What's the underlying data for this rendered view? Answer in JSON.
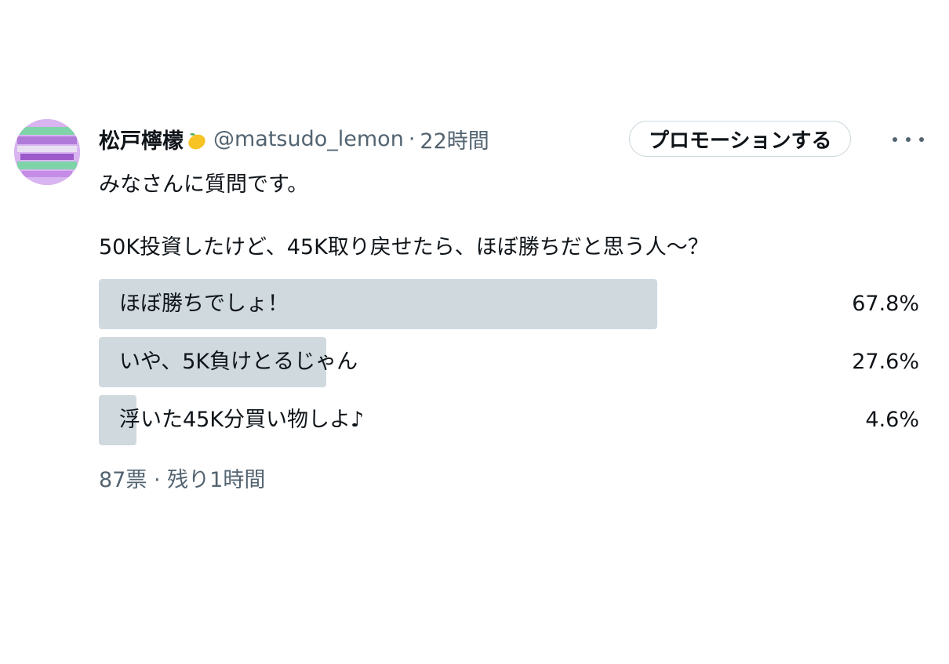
{
  "post": {
    "display_name": "松戸檸檬",
    "handle": "@matsudo_lemon",
    "separator": "·",
    "time": "22時間",
    "promote_label": "プロモーションする",
    "text": "みなさんに質問です。\n\n50K投資したけど、45K取り戻せたら、ほぼ勝ちだと思う人～？",
    "avatar_icon": "profile-avatar",
    "lemon_icon": "lemon-icon",
    "more_icon": "more-options-icon"
  },
  "poll": {
    "options": [
      {
        "label": "ほぼ勝ちでしょ！",
        "percent": "67.8%",
        "fraction": 0.678
      },
      {
        "label": "いや、5K負けとるじゃん",
        "percent": "27.6%",
        "fraction": 0.276
      },
      {
        "label": "浮いた45K分買い物しよ♪",
        "percent": "4.6%",
        "fraction": 0.046
      }
    ],
    "votes": "87票",
    "separator": "·",
    "remaining": "残り1時間"
  },
  "colors": {
    "bar": "#cfd9de",
    "secondary_text": "#536471",
    "primary_text": "#0f1419"
  }
}
